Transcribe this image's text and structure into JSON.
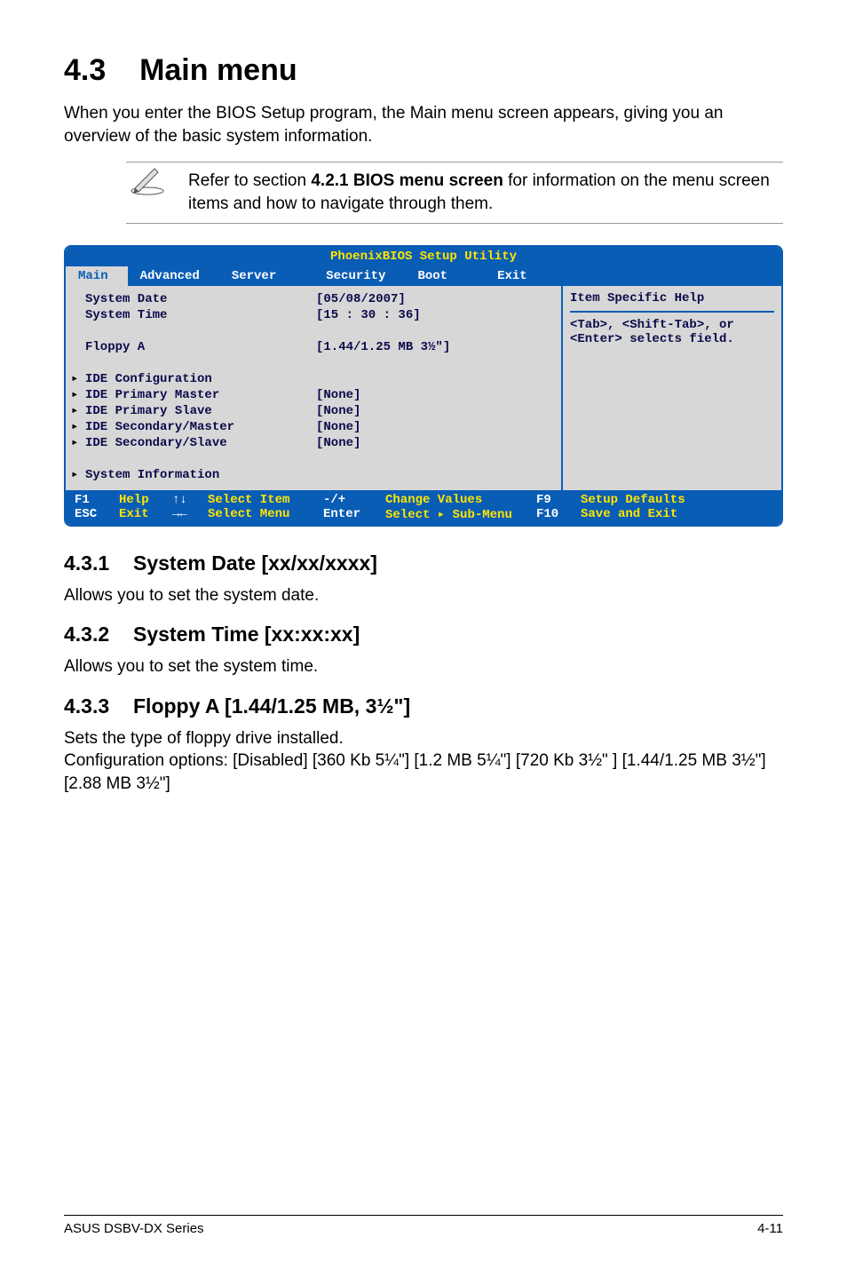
{
  "heading": {
    "number": "4.3",
    "title": "Main menu"
  },
  "intro": "When you enter the BIOS Setup program, the Main menu screen appears, giving you an overview of the basic system information.",
  "note": {
    "prefix": "Refer to section ",
    "bold": "4.2.1 BIOS menu screen",
    "suffix": " for information on the menu screen items and how to navigate through them."
  },
  "bios": {
    "title": "PhoenixBIOS Setup Utility",
    "tabs": [
      "Main",
      "Advanced",
      "Server",
      "Security",
      "Boot",
      "Exit"
    ],
    "activeTab": "Main",
    "rows": {
      "systemDateLabel": "System Date",
      "systemDateValue": "[05/08/2007]",
      "systemTimeLabel": "System Time",
      "systemTimeValue": "[15 : 30 : 36]",
      "floppyLabel": "Floppy A",
      "floppyValue": "[1.44/1.25 MB 3½\"]",
      "ideConfig": "IDE Configuration",
      "idePrimMaster": "IDE Primary Master",
      "idePrimMasterVal": "[None]",
      "idePrimSlave": "IDE Primary Slave",
      "idePrimSlaveVal": "[None]",
      "ideSecMaster": "IDE Secondary/Master",
      "ideSecMasterVal": "[None]",
      "ideSecSlave": "IDE Secondary/Slave",
      "ideSecSlaveVal": "[None]",
      "sysInfo": "System Information"
    },
    "help": {
      "title": "Item Specific Help",
      "line1": "<Tab>, <Shift-Tab>, or",
      "line2": "<Enter> selects field."
    },
    "footer": {
      "f1": "F1",
      "help": "Help",
      "updown": "↑↓",
      "selectItem": "Select Item",
      "plusminus": "-/+",
      "changeValues": "Change Values",
      "f9": "F9",
      "setupDefaults": "Setup Defaults",
      "esc": "ESC",
      "exit": "Exit",
      "leftright": "→←",
      "selectMenu": "Select Menu",
      "enter": "Enter",
      "selectSub": "Select ▸ Sub-Menu",
      "f10": "F10",
      "saveExit": "Save and Exit"
    }
  },
  "sections": {
    "s1num": "4.3.1",
    "s1title": "System Date [xx/xx/xxxx]",
    "s1body": "Allows you to set the system date.",
    "s2num": "4.3.2",
    "s2title": "System Time [xx:xx:xx]",
    "s2body": "Allows you to set the system time.",
    "s3num": "4.3.3",
    "s3title": "Floppy A [1.44/1.25 MB, 3½\"]",
    "s3body1": "Sets the type of floppy drive installed.",
    "s3body2": "Configuration options: [Disabled] [360 Kb  5¼\"] [1.2 MB  5¼\"] [720 Kb  3½\" ] [1.44/1.25 MB  3½\"] [2.88 MB  3½\"]"
  },
  "footer": {
    "left": "ASUS DSBV-DX Series",
    "right": "4-11"
  }
}
